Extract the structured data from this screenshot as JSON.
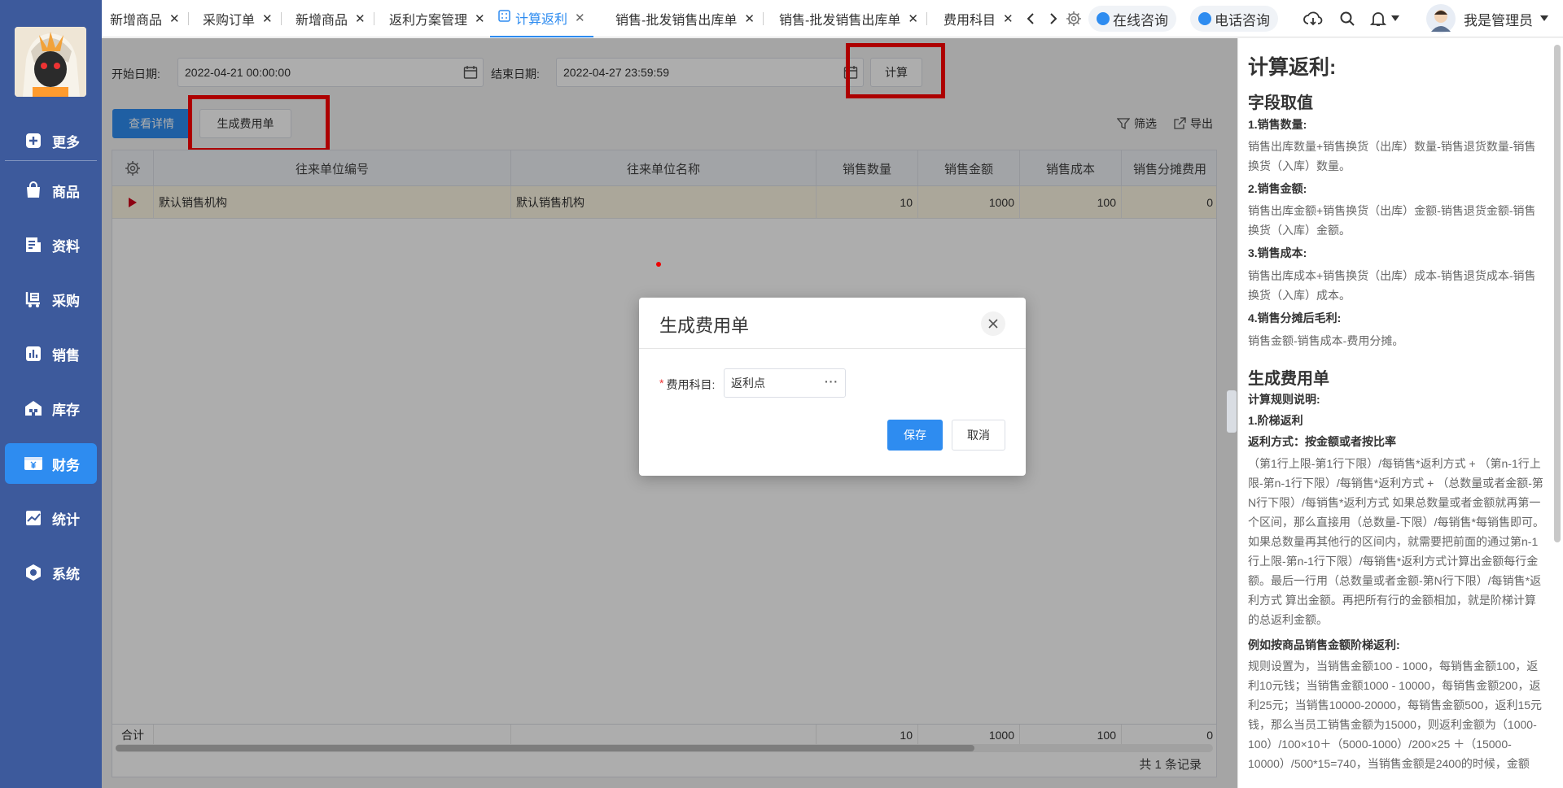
{
  "sidebar": {
    "items": [
      {
        "label": "更多",
        "icon": "plus-square-icon"
      },
      {
        "label": "商品",
        "icon": "bag-icon"
      },
      {
        "label": "资料",
        "icon": "document-icon"
      },
      {
        "label": "采购",
        "icon": "cart-icon"
      },
      {
        "label": "销售",
        "icon": "chart-icon"
      },
      {
        "label": "库存",
        "icon": "warehouse-icon"
      },
      {
        "label": "财务",
        "icon": "yen-icon"
      },
      {
        "label": "统计",
        "icon": "trend-icon"
      },
      {
        "label": "系统",
        "icon": "hexagon-gear-icon"
      }
    ]
  },
  "tabs": [
    {
      "label": "新增商品"
    },
    {
      "label": "采购订单"
    },
    {
      "label": "新增商品"
    },
    {
      "label": "返利方案管理"
    },
    {
      "label": "计算返利",
      "active": true
    },
    {
      "label": "销售-批发销售出库单"
    },
    {
      "label": "销售-批发销售出库单"
    },
    {
      "label": "费用科目"
    }
  ],
  "header": {
    "online_consult": "在线咨询",
    "phone_consult": "电话咨询",
    "user_name": "我是管理员"
  },
  "filter": {
    "start_label": "开始日期:",
    "start_value": "2022-04-21 00:00:00",
    "end_label": "结束日期:",
    "end_value": "2022-04-27 23:59:59",
    "calc_button": "计算"
  },
  "toolbar": {
    "view_detail": "查看详情",
    "generate_expense": "生成费用单",
    "filter": "筛选",
    "export": "导出"
  },
  "table": {
    "columns": [
      "往来单位编号",
      "往来单位名称",
      "销售数量",
      "销售金额",
      "销售成本",
      "销售分摊费用"
    ],
    "rows": [
      {
        "code": "默认销售机构",
        "name": "默认销售机构",
        "qty": "10",
        "amount": "1000",
        "cost": "100",
        "share": "0"
      }
    ],
    "footer": {
      "label": "合计",
      "qty": "10",
      "amount": "1000",
      "cost": "100",
      "share": "0"
    },
    "record_count": "共 1 条记录"
  },
  "modal": {
    "title": "生成费用单",
    "field_label": "费用科目:",
    "field_value": "返利点",
    "save": "保存",
    "cancel": "取消"
  },
  "panel": {
    "title": "计算返利:",
    "section1": "字段取值",
    "f1_title": "1.销售数量:",
    "f1_text": "销售出库数量+销售换货（出库）数量-销售退货数量-销售换货（入库）数量。",
    "f2_title": "2.销售金额:",
    "f2_text": "销售出库金额+销售换货（出库）金额-销售退货金额-销售换货（入库）金额。",
    "f3_title": "3.销售成本:",
    "f3_text": "销售出库成本+销售换货（出库）成本-销售退货成本-销售换货（入库）成本。",
    "f4_title": "4.销售分摊后毛利:",
    "f4_text": "销售金额-销售成本-费用分摊。",
    "section2": "生成费用单",
    "rule_title": "计算规则说明:",
    "rule1": "1.阶梯返利",
    "rule1_mode": "返利方式：按金额或者按比率",
    "rule1_text": "（第1行上限-第1行下限）/每销售*返利方式 + （第n-1行上限-第n-1行下限）/每销售*返利方式 + （总数量或者金额-第N行下限）/每销售*返利方式 如果总数量或者金额就再第一个区间，那么直接用（总数量-下限）/每销售*每销售即可。如果总数量再其他行的区间内，就需要把前面的通过第n-1行上限-第n-1行下限）/每销售*返利方式计算出金额每行金额。最后一行用（总数量或者金额-第N行下限）/每销售*返利方式 算出金额。再把所有行的金额相加，就是阶梯计算的总返利金额。",
    "example_title": "例如按商品销售金额阶梯返利:",
    "example_text": "规则设置为，当销售金额100 - 1000，每销售金额100，返利10元钱；当销售金额1000 - 10000，每销售金额200，返利25元；当销售10000-20000，每销售金额500，返利15元钱，那么当员工销售金额为15000，则返利金额为（1000-100）/100×10＋（5000-1000）/200×25 ＋（15000-10000）/500*15=740，当销售金额是2400的时候，金额"
  }
}
